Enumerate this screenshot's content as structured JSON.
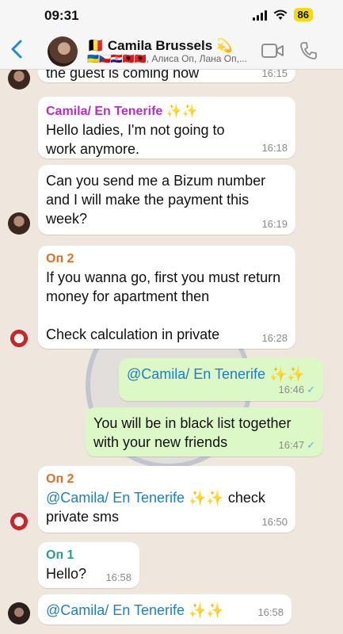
{
  "status_bar": {
    "time": "09:31",
    "battery": "86"
  },
  "header": {
    "title": "🇧🇪 Camila Brussels 💫",
    "subtitle": "🇺🇦🇨🇿🇭🇷🇦🇱🇦🇱, Алиса Оп, Лана Оп,..."
  },
  "messages": [
    {
      "text": "the guest is coming now",
      "time": "16:15"
    },
    {
      "sender": "Camila/ En Tenerife ✨✨",
      "text": "Hello ladies, I'm not going to work anymore.",
      "time": "16:18"
    },
    {
      "text": "Can you send me a Bizum number and I will make the payment this week?",
      "time": "16:19"
    },
    {
      "sender": "Оп 2",
      "line1": "If you wanna go, first you must return money for apartment then",
      "line2": "Check calculation in private",
      "time": "16:28"
    },
    {
      "mention": "@Camila/ En Tenerife ✨✨",
      "time": "16:46"
    },
    {
      "text": "You will be in black list together with your new friends",
      "time": "16:47"
    },
    {
      "sender": "Оп 2",
      "mention": "@Camila/ En Tenerife ✨✨",
      "rest": " check private sms",
      "time": "16:50"
    },
    {
      "sender": "Оп 1",
      "text": "Hello?",
      "time": "16:58"
    },
    {
      "mention": "@Camila/ En Tenerife ✨✨",
      "time": "16:58"
    }
  ],
  "watermark": {
    "top_text": "THE VICE CITY",
    "bottom_text": "POLICE DEPARTMENT"
  }
}
